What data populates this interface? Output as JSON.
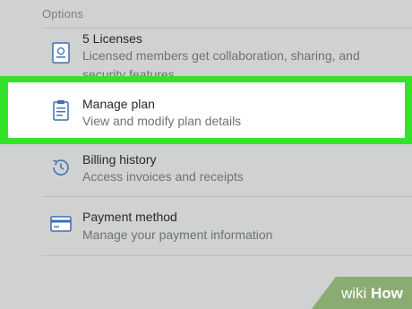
{
  "section": {
    "title": "Options"
  },
  "options": [
    {
      "icon": "license-card-icon",
      "title": "5 Licenses",
      "description": "Licensed members get collaboration, sharing, and security features."
    },
    {
      "icon": "clipboard-icon",
      "title": "Manage plan",
      "description": "View and modify plan details"
    },
    {
      "icon": "clock-history-icon",
      "title": "Billing history",
      "description": "Access invoices and receipts"
    },
    {
      "icon": "credit-card-icon",
      "title": "Payment method",
      "description": "Manage your payment information"
    }
  ],
  "colors": {
    "highlight": "#35e22a",
    "icon": "#3d6fb4"
  },
  "watermark": {
    "part1": "wiki",
    "part2": "How"
  }
}
